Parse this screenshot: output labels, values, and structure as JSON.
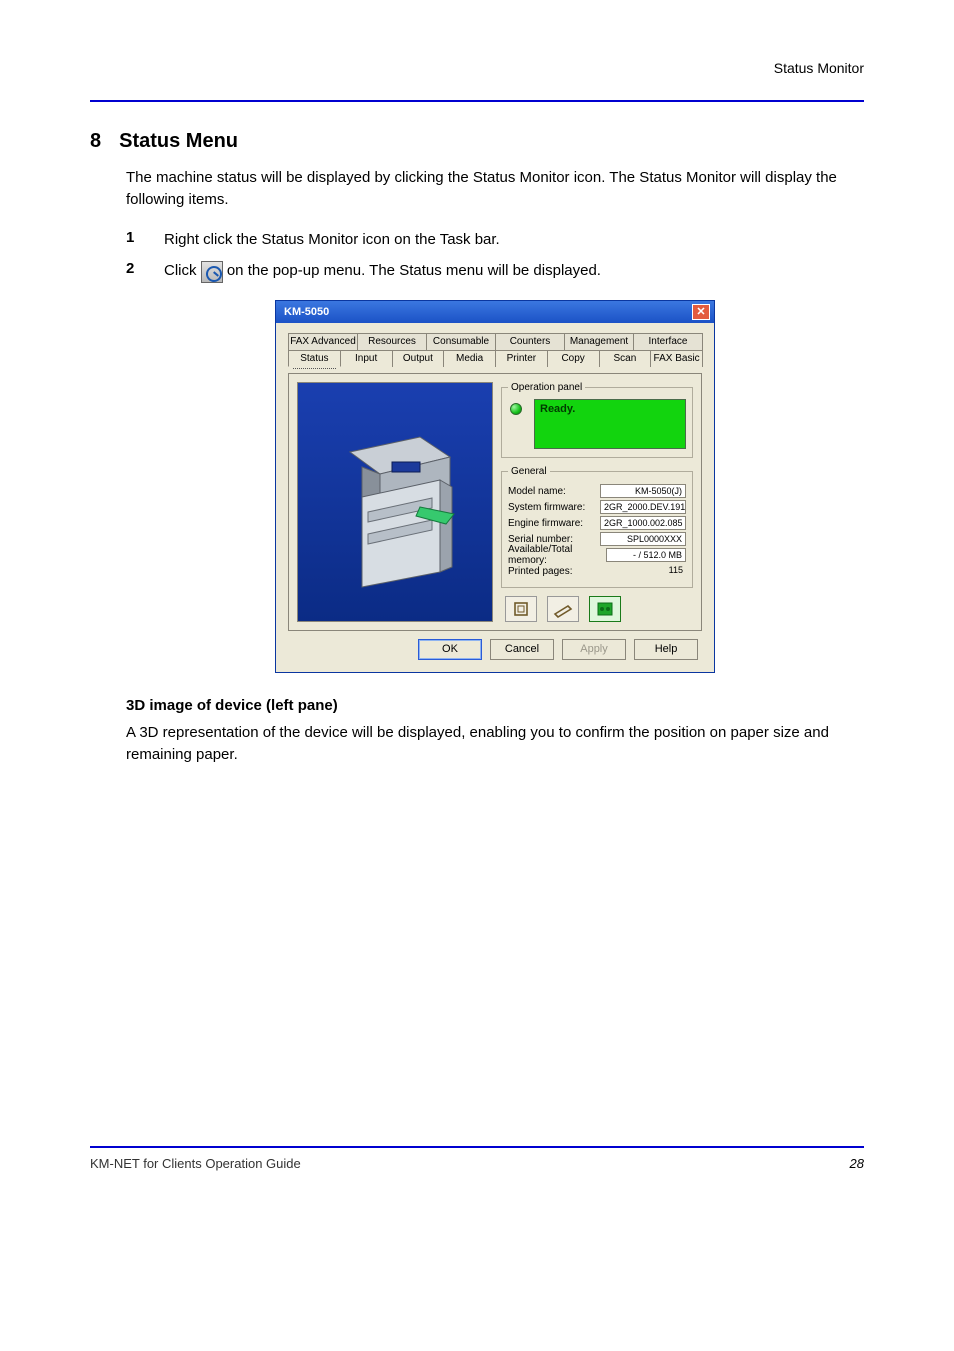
{
  "header": {
    "right_label": "Status Monitor"
  },
  "section": {
    "number": "8",
    "title": "Status Menu",
    "intro": "The machine status will be displayed by clicking the Status Monitor icon. The Status Monitor will display the following items."
  },
  "steps": {
    "s1": {
      "num": "1",
      "text": "Right click the Status Monitor icon on the Task bar."
    },
    "s2": {
      "num": "2",
      "text_before": "Click ",
      "text_after": " on the pop-up menu. The Status menu will be displayed."
    }
  },
  "dialog": {
    "title": "KM-5050",
    "tabs_back": [
      "FAX Advanced",
      "Resources",
      "Consumable",
      "Counters",
      "Management",
      "Interface"
    ],
    "tabs_front": [
      "Status",
      "Input",
      "Output",
      "Media",
      "Printer",
      "Copy",
      "Scan",
      "FAX Basic"
    ],
    "active_tab_index": 0,
    "op_panel": {
      "legend": "Operation panel",
      "lcd_text": "Ready."
    },
    "general": {
      "legend": "General",
      "rows": [
        {
          "label": "Model name:",
          "value": "KM-5050(J)"
        },
        {
          "label": "System firmware:",
          "value": "2GR_2000.DEV.191"
        },
        {
          "label": "Engine firmware:",
          "value": "2GR_1000.002.085"
        },
        {
          "label": "Serial number:",
          "value": "SPL0000XXX"
        },
        {
          "label": "Available/Total memory:",
          "value": "- / 512.0 MB"
        },
        {
          "label": "Printed pages:",
          "value": "115"
        }
      ]
    },
    "buttons": {
      "ok": "OK",
      "cancel": "Cancel",
      "apply": "Apply",
      "help": "Help"
    }
  },
  "device": {
    "heading": "3D image of device (left pane)",
    "body": "A 3D representation of the device will be displayed, enabling you to confirm the position on paper size and remaining paper."
  },
  "footer": {
    "left": "KM-NET for Clients Operation Guide",
    "page": "28"
  }
}
